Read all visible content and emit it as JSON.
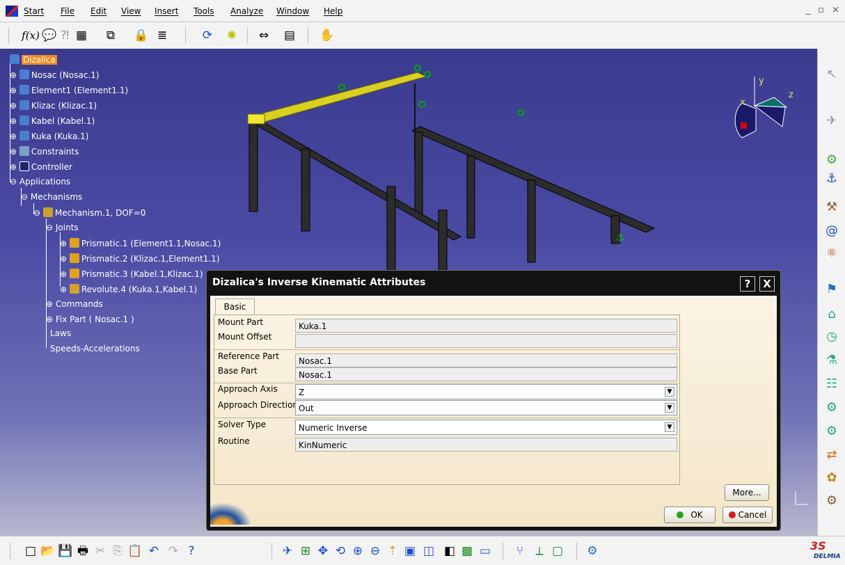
{
  "menu": {
    "items": [
      "Start",
      "File",
      "Edit",
      "View",
      "Insert",
      "Tools",
      "Analyze",
      "Window",
      "Help"
    ],
    "window_controls": [
      "_",
      "▫",
      "×"
    ]
  },
  "tree": {
    "root": "Dizalica",
    "nodes": [
      "Nosac (Nosac.1)",
      "Element1 (Element1.1)",
      "Klizac (Klizac.1)",
      "Kabel (Kabel.1)",
      "Kuka (Kuka.1)",
      "Constraints",
      "Controller",
      "Applications",
      "Mechanisms",
      "Mechanism.1, DOF=0",
      "Joints",
      "Prismatic.1 (Element1.1,Nosac.1)",
      "Prismatic.2 (Klizac.1,Element1.1)",
      "Prismatic.3 (Kabel.1,Klizac.1)",
      "Revolute.4 (Kuka.1,Kabel.1)",
      "Commands",
      "Fix Part ( Nosac.1 )",
      "Laws",
      "Speeds-Accelerations"
    ]
  },
  "compass": {
    "x": "x",
    "y": "y",
    "z": "z"
  },
  "dialog": {
    "title": "Dizalica's Inverse Kinematic Attributes",
    "help": "?",
    "close": "X",
    "tab": "Basic",
    "fields": {
      "mount_part": {
        "label": "Mount Part",
        "value": "Kuka.1"
      },
      "mount_offset": {
        "label": "Mount Offset",
        "value": ""
      },
      "reference_part": {
        "label": "Reference Part",
        "value": "Nosac.1"
      },
      "base_part": {
        "label": "Base Part",
        "value": "Nosac.1"
      },
      "approach_axis": {
        "label": "Approach Axis",
        "value": "Z"
      },
      "approach_direction": {
        "label": "Approach Direction",
        "value": "Out"
      },
      "solver_type": {
        "label": "Solver Type",
        "value": "Numeric Inverse"
      },
      "routine": {
        "label": "Routine",
        "value": "KinNumeric"
      }
    },
    "more": "More...",
    "ok": "OK",
    "cancel": "Cancel"
  },
  "brand": "DELMIA",
  "colors": {
    "viewport": "#4b4ba4",
    "selected": "#f08a20",
    "dialog_bg": "#fbf4e4"
  }
}
